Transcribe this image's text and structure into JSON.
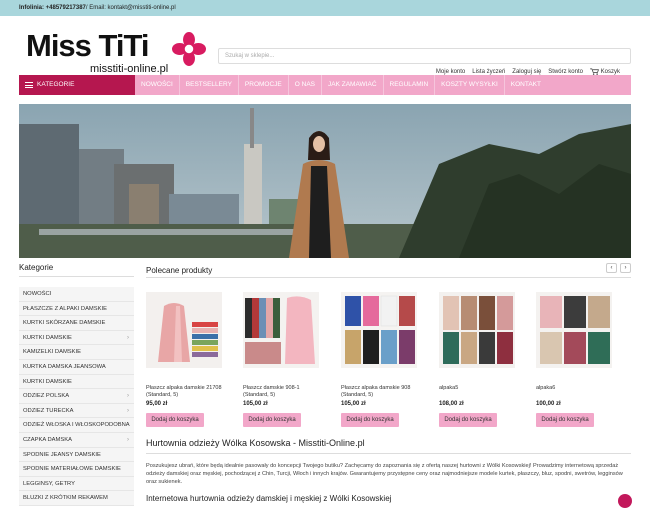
{
  "topbar": {
    "label": "Infolinia: ",
    "phone": "+48579217387",
    "email_text": "/ Email: kontakt@misstiti-online.pl"
  },
  "logo": {
    "main": "Miss TiTi",
    "sub": "misstiti-online.pl"
  },
  "search": {
    "placeholder": "Szukaj w sklepie..."
  },
  "usermenu": [
    "Moje konto",
    "Lista życzeń",
    "Zaloguj się",
    "Stwórz konto",
    "Koszyk"
  ],
  "nav": {
    "categories_label": "KATEGORIE",
    "items": [
      "NOWOŚCI",
      "BESTSELLERY",
      "PROMOCJE",
      "O NAS",
      "JAK ZAMAWIAĆ",
      "REGULAMIN",
      "KOSZTY WYSYŁKI",
      "KONTAKT"
    ]
  },
  "sidebar": {
    "title": "Kategorie",
    "items": [
      {
        "label": "NOWOŚCI",
        "sub": false
      },
      {
        "label": "PŁASZCZE Z ALPAKI DAMSKIE",
        "sub": false
      },
      {
        "label": "KURTKI SKÓRZANE DAMSKIE",
        "sub": false
      },
      {
        "label": "KURTKI DAMSKIE",
        "sub": true
      },
      {
        "label": "KAMIZELKI DAMSKIE",
        "sub": false
      },
      {
        "label": "KURTKA DAMSKA JEANSOWA",
        "sub": false
      },
      {
        "label": "KURTKI DAMSKIE",
        "sub": false
      },
      {
        "label": "ODZIEZ POLSKA",
        "sub": true
      },
      {
        "label": "ODZIEZ TURECKA",
        "sub": true
      },
      {
        "label": "ODZIEŻ WŁOSKA I WŁOSKOPODOBNA",
        "sub": false
      },
      {
        "label": "CZAPKA DAMSKA",
        "sub": true
      },
      {
        "label": "SPODNIE JEANSY DAMSKIE",
        "sub": false
      },
      {
        "label": "SPODNIE MATERIAŁOWE DAMSKIE",
        "sub": false
      },
      {
        "label": "LEGGINSY, GETRY",
        "sub": false
      },
      {
        "label": "BLUZKI Z KRÓTKIM REKAWEM",
        "sub": false
      }
    ]
  },
  "recommended": {
    "title": "Polecane produkty",
    "prev": "‹",
    "next": "›",
    "add_label": "Dodaj do koszyka",
    "products": [
      {
        "name": "Płaszcz alpaka damskie 21708 (Standard, 5)",
        "price": "95,00 zł"
      },
      {
        "name": "Płaszcz damskie 908-1 (Standard, 5)",
        "price": "105,00 zł"
      },
      {
        "name": "Płaszcz alpaka damskie 908 (Standard, 5)",
        "price": "105,00 zł"
      },
      {
        "name": "alpaka5",
        "price": "108,00 zł"
      },
      {
        "name": "alpaka6",
        "price": "100,00 zł"
      }
    ]
  },
  "about": {
    "title": "Hurtownia odzieży Wólka Kosowska - Misstiti-Online.pl",
    "paragraph": "Poszukujesz ubrań, które będą idealnie pasowały do koncepcji Twojego butiku? Zachęcamy do zapoznania się z ofertą naszej hurtowni z Wólki Kosowskiej! Prowadzimy internetową sprzedaż odzieży damskiej oraz męskiej, pochodzącej z Chin, Turcji, Włoch i innych krajów. Gwarantujemy przystępne ceny oraz najmodniejsze modele kurtek, płaszczy, bluz, spodni, swetrów, legginsów oraz sukienek.",
    "subtitle": "Internetowa hurtownia odzieży damskiej i męskiej z Wólki Kosowskiej"
  },
  "colors": {
    "nav_bg": "#f2a7c9",
    "category_bg": "#b5174f",
    "topbar_bg": "#a9d6dc",
    "button_bg": "#f2a7c9"
  }
}
